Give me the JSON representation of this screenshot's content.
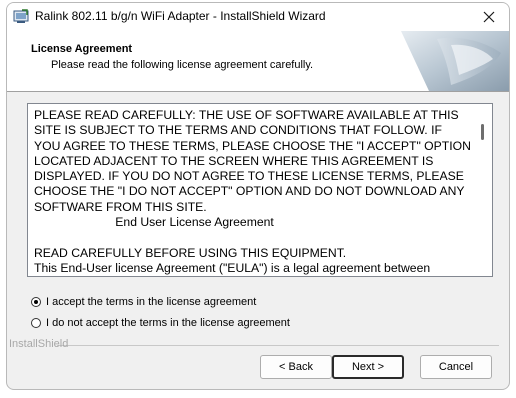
{
  "window": {
    "title": "Ralink 802.11 b/g/n WiFi Adapter - InstallShield Wizard",
    "close_glyph": "✕"
  },
  "header": {
    "title": "License Agreement",
    "subtitle": "Please read the following license agreement carefully."
  },
  "license": {
    "text": "PLEASE READ CAREFULLY: THE USE OF SOFTWARE AVAILABLE AT THIS\nSITE IS SUBJECT TO THE TERMS AND CONDITIONS THAT FOLLOW. IF\nYOU AGREE TO THESE TERMS, PLEASE CHOOSE THE \"I ACCEPT\" OPTION\nLOCATED ADJACENT TO THE SCREEN WHERE THIS AGREEMENT IS\nDISPLAYED. IF YOU DO NOT AGREE TO THESE LICENSE TERMS, PLEASE\nCHOOSE THE \"I DO NOT ACCEPT\" OPTION AND DO NOT DOWNLOAD ANY\nSOFTWARE FROM THIS SITE.\n                        End User License Agreement\n\nREAD CAREFULLY BEFORE USING THIS EQUIPMENT.\nThis End-User license Agreement (\"EULA\") is a legal agreement between"
  },
  "options": {
    "accept_label": "I accept the terms in the license agreement",
    "decline_label": "I do not accept the terms in the license agreement",
    "selected": "accept"
  },
  "footer": {
    "brand": "InstallShield",
    "back_label": "< Back",
    "next_label": "Next >",
    "cancel_label": "Cancel"
  },
  "colors": {
    "window_bg": "#f0f0f0",
    "header_bg": "#ffffff",
    "brand_text": "#a8a8a8"
  }
}
